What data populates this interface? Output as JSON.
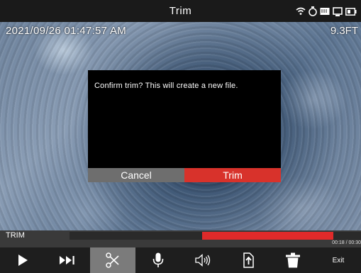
{
  "header": {
    "title": "Trim"
  },
  "status_icons": [
    "wifi-icon",
    "timer-icon",
    "storage-icon",
    "display-icon",
    "battery-icon"
  ],
  "overlay": {
    "timestamp": "2021/09/26 01:47:57 AM",
    "distance": "9.3FT"
  },
  "dialog": {
    "message": "Confirm trim? This will create a new file.",
    "cancel_label": "Cancel",
    "confirm_label": "Trim"
  },
  "timeline": {
    "label": "TRIM",
    "time": "00:18 / 00:30",
    "selection_start": 0.456,
    "selection_end": 0.906
  },
  "toolbar": {
    "items": [
      {
        "icon": "play-icon"
      },
      {
        "icon": "skip-forward-icon"
      },
      {
        "icon": "scissors-icon",
        "active": true
      },
      {
        "icon": "microphone-icon"
      },
      {
        "icon": "speaker-icon"
      },
      {
        "icon": "export-icon"
      },
      {
        "icon": "trash-icon"
      },
      {
        "label": "Exit"
      }
    ]
  },
  "colors": {
    "accent": "#d8322b",
    "cancel": "#6e6e6e",
    "active_tool": "#7b7b7b"
  }
}
